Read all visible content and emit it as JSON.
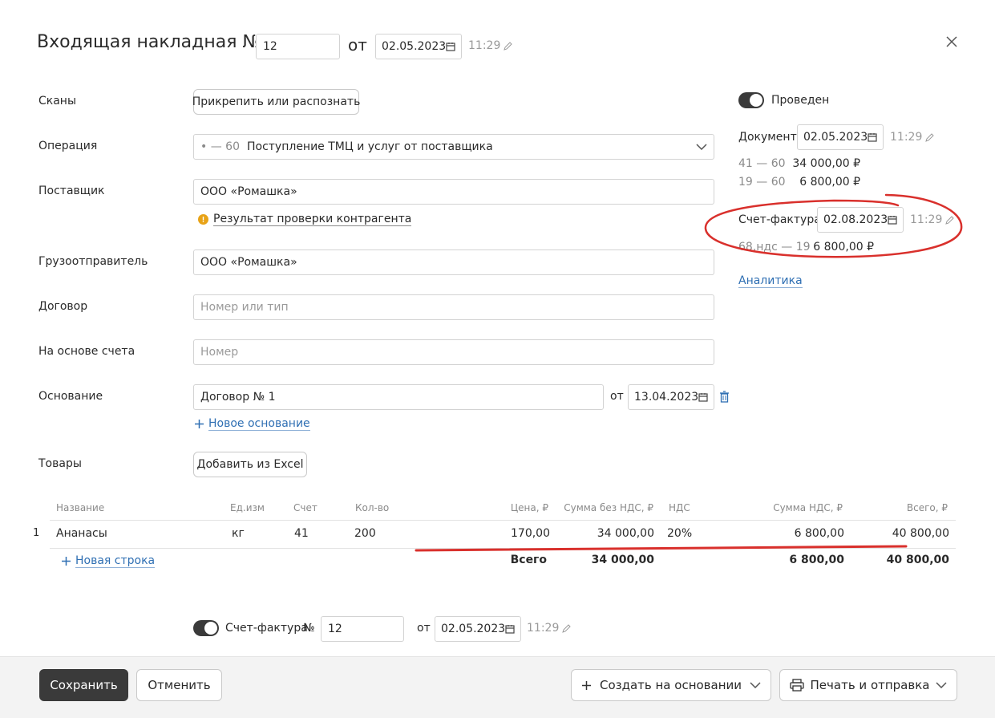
{
  "header": {
    "title": "Входящая накладная №",
    "number": "12",
    "from_label": "от",
    "date": "02.05.2023",
    "time": "11:29"
  },
  "form": {
    "scans": {
      "label": "Сканы",
      "button": "Прикрепить или распознать"
    },
    "operation": {
      "label": "Операция",
      "code": "• — 60",
      "value": "Поступление ТМЦ и услуг от поставщика"
    },
    "supplier": {
      "label": "Поставщик",
      "value": "ООО «Ромашка»",
      "check_link": "Результат проверки контрагента"
    },
    "shipper": {
      "label": "Грузоотправитель",
      "value": "ООО «Ромашка»"
    },
    "contract": {
      "label": "Договор",
      "placeholder": "Номер или тип"
    },
    "invoice_basis": {
      "label": "На основе счета",
      "placeholder": "Номер"
    },
    "basis": {
      "label": "Основание",
      "value": "Договор № 1",
      "from_label": "от",
      "date": "13.04.2023",
      "add_link": "Новое основание"
    },
    "goods": {
      "label": "Товары",
      "button": "Добавить из Excel"
    }
  },
  "table": {
    "headers": {
      "name": "Название",
      "unit": "Ед.изм",
      "account": "Счет",
      "qty": "Кол-во",
      "price": "Цена, ₽",
      "sum_no_vat": "Сумма без НДС, ₽",
      "vat": "НДС",
      "vat_sum": "Сумма НДС, ₽",
      "total": "Всего, ₽"
    },
    "rows": [
      {
        "index": "1",
        "name": "Ананасы",
        "unit": "кг",
        "account": "41",
        "qty": "200",
        "price": "170,00",
        "sum_no_vat": "34 000,00",
        "vat": "20%",
        "vat_sum": "6 800,00",
        "total": "40 800,00"
      }
    ],
    "new_row_link": "Новая строка",
    "totals": {
      "label": "Всего",
      "sum_no_vat": "34 000,00",
      "vat_sum": "6 800,00",
      "total": "40 800,00"
    }
  },
  "invoice_footer": {
    "label": "Счет-фактура",
    "number_label": "№",
    "number": "12",
    "from_label": "от",
    "date": "02.05.2023",
    "time": "11:29"
  },
  "side": {
    "posted_label": "Проведен",
    "document": {
      "label": "Документ",
      "date": "02.05.2023",
      "time": "11:29"
    },
    "entries": [
      {
        "accounts": "41 — 60",
        "amount": "34 000,00 ₽"
      },
      {
        "accounts": "19 — 60",
        "amount": "6 800,00 ₽"
      }
    ],
    "invoice": {
      "label": "Счет-фактура",
      "date": "02.08.2023",
      "time": "11:29",
      "entry": {
        "accounts": "68.ндс — 19",
        "amount": "6 800,00 ₽"
      }
    },
    "analytics_link": "Аналитика"
  },
  "footer": {
    "save": "Сохранить",
    "cancel": "Отменить",
    "create_based": "Создать на основании",
    "print_send": "Печать и отправка"
  },
  "colors": {
    "annotation": "#d9302c",
    "link": "#2f6fb3",
    "primary_button": "#3a3a3a",
    "warning": "#e8a317"
  },
  "icons": [
    "pencil-icon",
    "calendar-icon",
    "close-icon",
    "chevron-down-icon",
    "trash-icon",
    "plus-icon",
    "printer-icon",
    "warning-icon"
  ]
}
